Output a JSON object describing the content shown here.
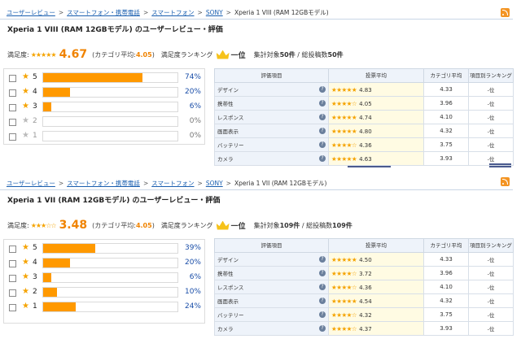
{
  "panels": [
    {
      "breadcrumb": [
        "ユーザーレビュー",
        "スマートフォン・携帯電話",
        "スマートフォン",
        "SONY",
        "Xperia 1 VIII (RAM 12GBモデル)"
      ],
      "title": "Xperia 1 VIII (RAM 12GBモデル) のユーザーレビュー・評価",
      "satisfaction_label": "満足度:",
      "stars": "★★★★★",
      "score": "4.67",
      "category_avg_label": "(カテゴリ平均:",
      "category_avg": "4.05",
      "category_avg_close": ")",
      "ranking_label": "満足度ランキング",
      "ranking_value": "一位",
      "counts": {
        "a": "集計対象",
        "b": "50件",
        "c": " / 総投稿数",
        "d": "50件"
      },
      "distribution": [
        {
          "n": "5",
          "pct": "74%",
          "level": 0.74,
          "active": true
        },
        {
          "n": "4",
          "pct": "20%",
          "level": 0.2,
          "active": true
        },
        {
          "n": "3",
          "pct": "6%",
          "level": 0.06,
          "active": true
        },
        {
          "n": "2",
          "pct": "0%",
          "level": 0,
          "active": false
        },
        {
          "n": "1",
          "pct": "0%",
          "level": 0,
          "active": false
        }
      ],
      "table_headers": [
        "評価項目",
        "投票平均",
        "カテゴリ平均",
        "項目別ランキング"
      ],
      "rows": [
        {
          "item": "デザイン",
          "stars": "★★★★★",
          "avg": "4.83",
          "cat": "4.33",
          "rank": "-位"
        },
        {
          "item": "携帯性",
          "stars": "★★★★☆",
          "avg": "4.05",
          "cat": "3.96",
          "rank": "-位"
        },
        {
          "item": "レスポンス",
          "stars": "★★★★★",
          "avg": "4.74",
          "cat": "4.10",
          "rank": "-位"
        },
        {
          "item": "画面表示",
          "stars": "★★★★★",
          "avg": "4.80",
          "cat": "4.32",
          "rank": "-位"
        },
        {
          "item": "バッテリー",
          "stars": "★★★★☆",
          "avg": "4.36",
          "cat": "3.75",
          "rank": "-位"
        },
        {
          "item": "カメラ",
          "stars": "★★★★★",
          "avg": "4.63",
          "cat": "3.93",
          "rank": "-位"
        }
      ]
    },
    {
      "breadcrumb": [
        "ユーザーレビュー",
        "スマートフォン・携帯電話",
        "スマートフォン",
        "SONY",
        "Xperia 1 VII (RAM 12GBモデル)"
      ],
      "title": "Xperia 1 VII (RAM 12GBモデル) のユーザーレビュー・評価",
      "satisfaction_label": "満足度:",
      "stars": "★★★☆☆",
      "score": "3.48",
      "category_avg_label": "(カテゴリ平均:",
      "category_avg": "4.05",
      "category_avg_close": ")",
      "ranking_label": "満足度ランキング",
      "ranking_value": "一位",
      "counts": {
        "a": "集計対象",
        "b": "109件",
        "c": " / 総投稿数",
        "d": "109件"
      },
      "distribution": [
        {
          "n": "5",
          "pct": "39%",
          "level": 0.39,
          "active": true
        },
        {
          "n": "4",
          "pct": "20%",
          "level": 0.2,
          "active": true
        },
        {
          "n": "3",
          "pct": "6%",
          "level": 0.06,
          "active": true
        },
        {
          "n": "2",
          "pct": "10%",
          "level": 0.1,
          "active": true
        },
        {
          "n": "1",
          "pct": "24%",
          "level": 0.24,
          "active": true
        }
      ],
      "table_headers": [
        "評価項目",
        "投票平均",
        "カテゴリ平均",
        "項目別ランキング"
      ],
      "rows": [
        {
          "item": "デザイン",
          "stars": "★★★★★",
          "avg": "4.50",
          "cat": "4.33",
          "rank": "-位"
        },
        {
          "item": "携帯性",
          "stars": "★★★★☆",
          "avg": "3.72",
          "cat": "3.96",
          "rank": "-位"
        },
        {
          "item": "レスポンス",
          "stars": "★★★★☆",
          "avg": "4.36",
          "cat": "4.10",
          "rank": "-位"
        },
        {
          "item": "画面表示",
          "stars": "★★★★★",
          "avg": "4.54",
          "cat": "4.32",
          "rank": "-位"
        },
        {
          "item": "バッテリー",
          "stars": "★★★★☆",
          "avg": "4.32",
          "cat": "3.75",
          "rank": "-位"
        },
        {
          "item": "カメラ",
          "stars": "★★★★☆",
          "avg": "4.37",
          "cat": "3.93",
          "rank": "-位"
        }
      ]
    }
  ],
  "colors": {
    "accent": "#f08300",
    "bar": "#ff9900",
    "link": "#1a5fb0",
    "star": "#f5a300"
  }
}
